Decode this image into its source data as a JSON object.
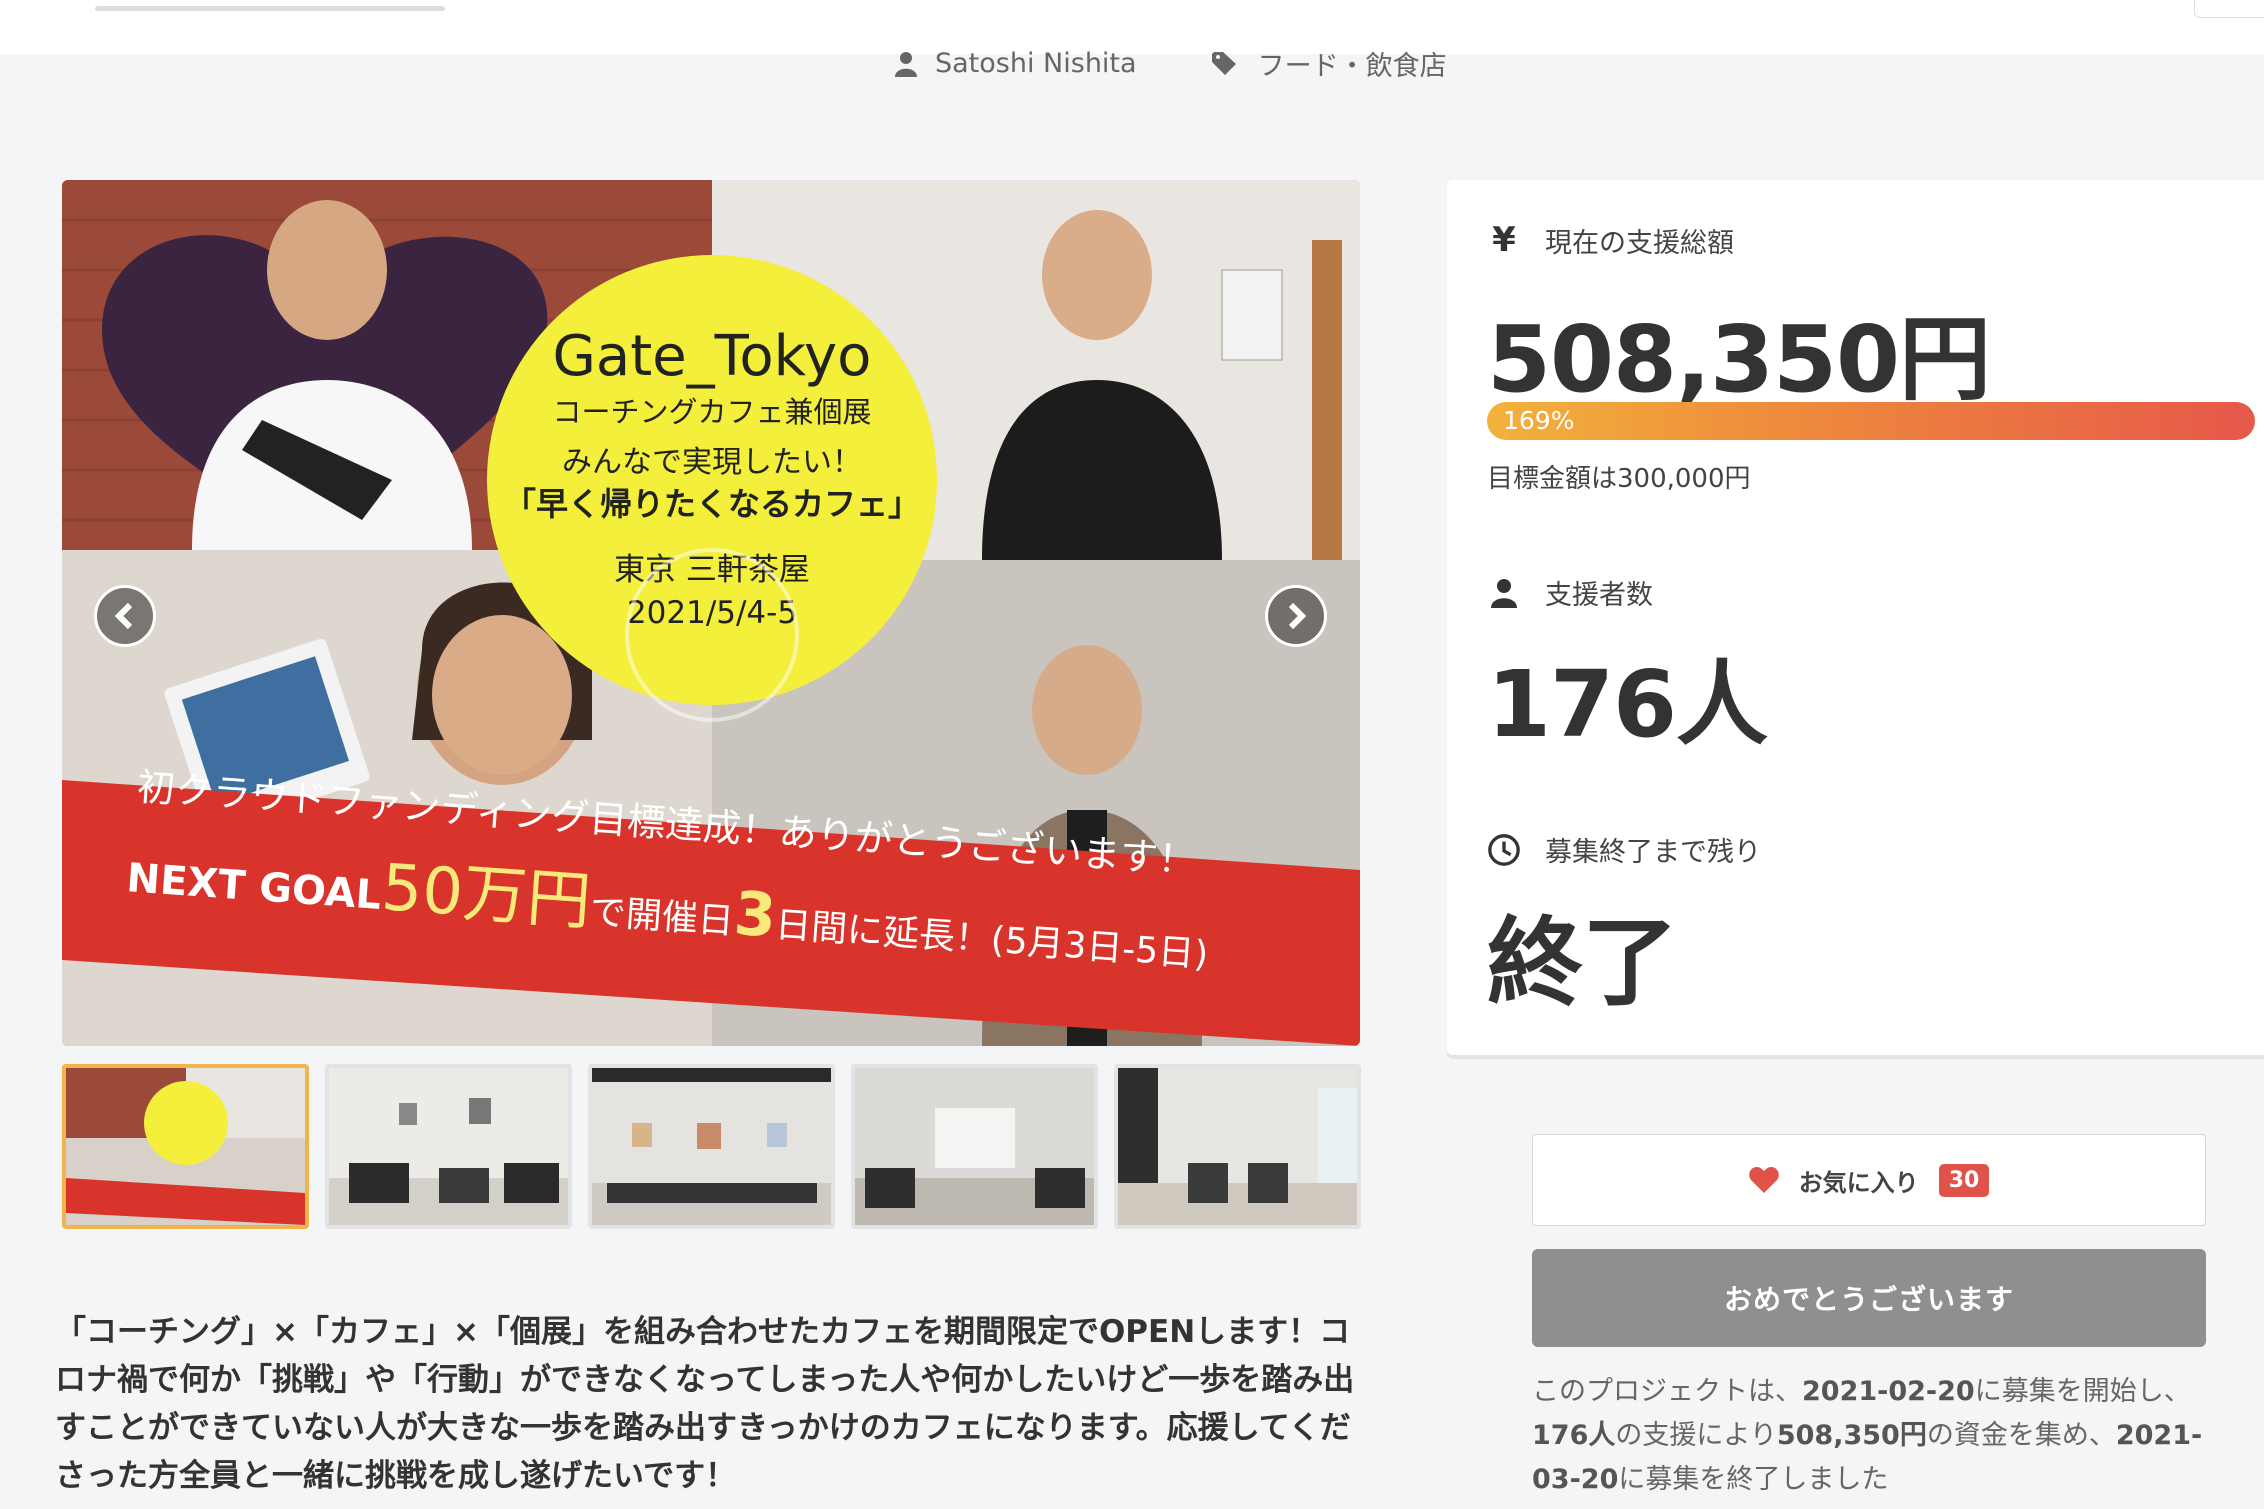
{
  "header": {
    "author": "Satoshi Nishita",
    "category": "フード・飲食店"
  },
  "gallery": {
    "main_image": {
      "title": "Gate_Tokyo",
      "line1": "コーチングカフェ兼個展",
      "line2": "みんなで実現したい！",
      "line3": "「早く帰りたくなるカフェ」",
      "location": "東京 三軒茶屋",
      "dates": "2021/5/4-5",
      "banner_line1": "初クラウドファンディング目標達成！ありがとうございます！",
      "banner_line2_a": "NEXT GOAL",
      "banner_line2_b": "50万円",
      "banner_line2_c": "で開催日",
      "banner_line2_d": "3",
      "banner_line2_e": "日間に延長！(5月3日-5日)"
    },
    "thumbnail_count": 5
  },
  "description": "「コーチング」×「カフェ」×「個展」を組み合わせたカフェを期間限定でOPENします！コロナ禍で何か「挑戦」や「行動」ができなくなってしまった人や何かしたいけど一歩を踏み出すことができていない人が大きな一歩を踏み出すきっかけのカフェになります。応援してくださった方全員と一緒に挑戦を成し遂げたいです！",
  "stats": {
    "total_label": "現在の支援総額",
    "total_value": "508,350円",
    "percent_label": "169%",
    "percent": 169,
    "goal_text": "目標金額は300,000円",
    "supporters_label": "支援者数",
    "supporters_value": "176人",
    "remaining_label": "募集終了まで残り",
    "remaining_value": "終了"
  },
  "actions": {
    "favorite_label": "お気に入り",
    "favorite_count": "30",
    "congrats_label": "おめでとうございます"
  },
  "summary": {
    "p1": "このプロジェクトは、",
    "start_date": "2021-02-20",
    "p2": "に募集を開始し、",
    "supporters": "176人",
    "p3": "の支援により",
    "amount": "508,350円",
    "p4": "の資金を集め、",
    "end_date": "2021-03-20",
    "p5": "に募集を終了しました"
  },
  "colors": {
    "accent_red": "#e0534a",
    "bar_start": "#f2b23c",
    "bar_end": "#e6584a",
    "banner_red": "#d9342b",
    "circle_yellow": "#f3ef3a"
  }
}
